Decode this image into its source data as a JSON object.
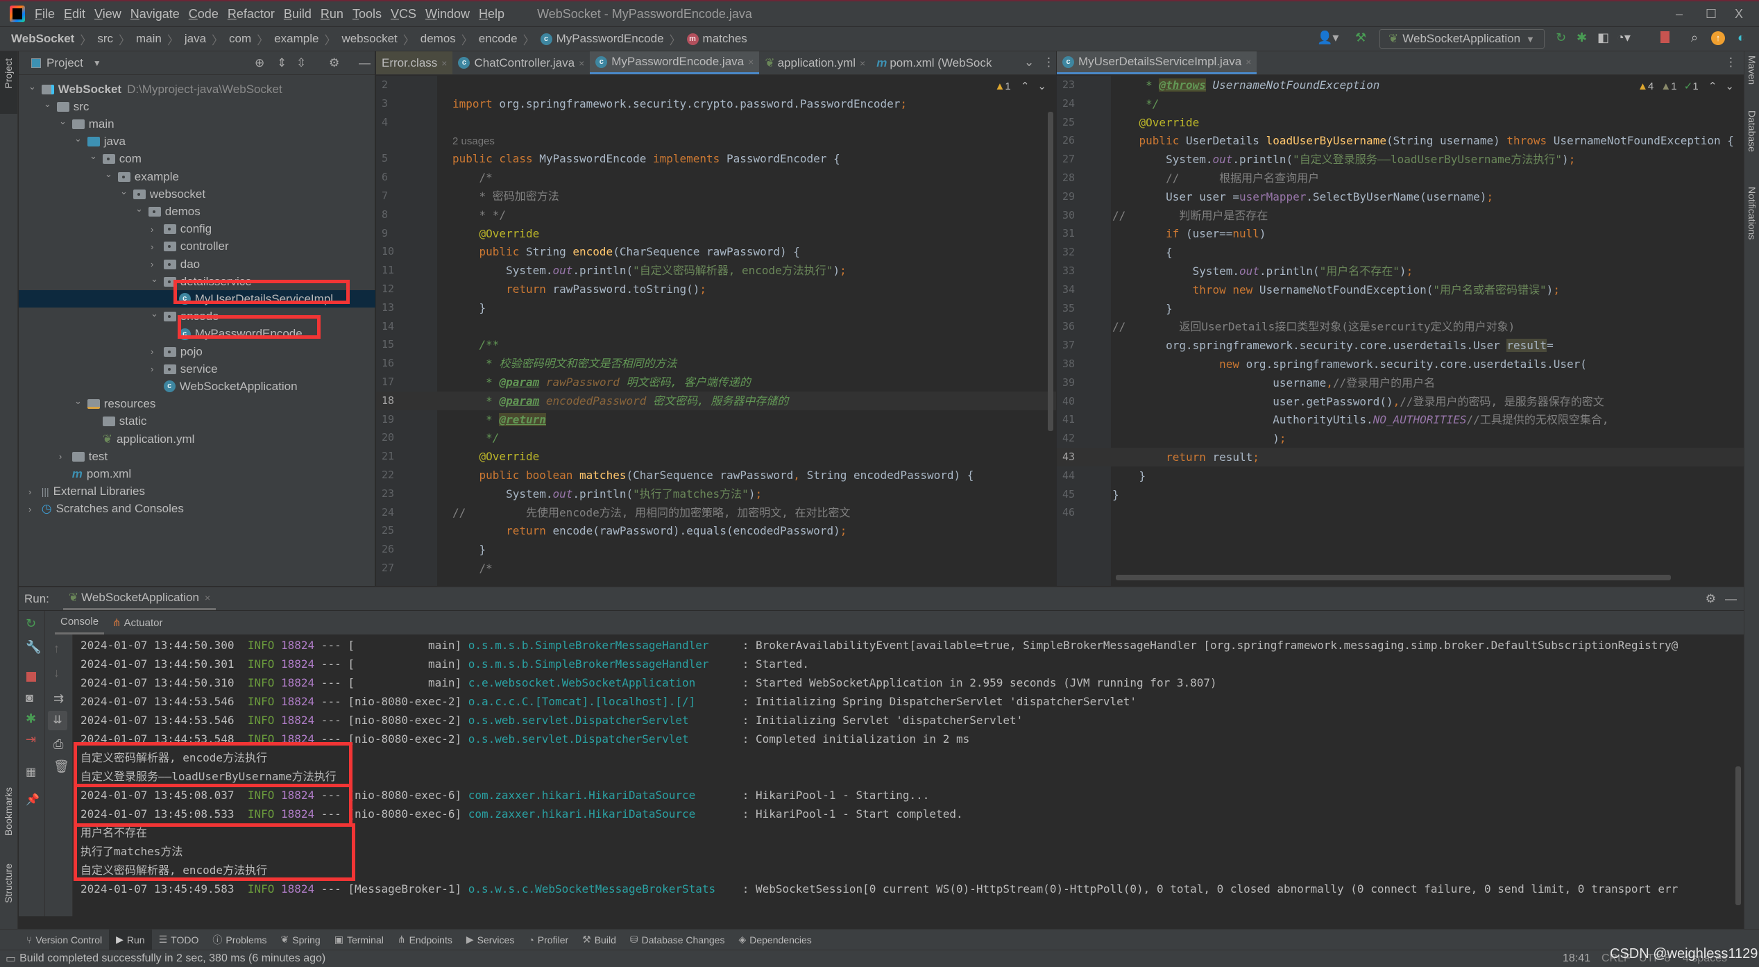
{
  "window": {
    "title": "WebSocket - MyPasswordEncode.java",
    "menu": [
      "File",
      "Edit",
      "View",
      "Navigate",
      "Code",
      "Refactor",
      "Build",
      "Run",
      "Tools",
      "VCS",
      "Window",
      "Help"
    ],
    "controls": {
      "minimize": "–",
      "maximize": "☐",
      "close": "X"
    }
  },
  "breadcrumb": {
    "items": [
      "WebSocket",
      "src",
      "main",
      "java",
      "com",
      "example",
      "websocket",
      "demos",
      "encode",
      "MyPasswordEncode",
      "matches"
    ]
  },
  "toolbar": {
    "run_config": "WebSocketApplication"
  },
  "side_strips": {
    "left_top": "Project",
    "left_bottom": [
      "Bookmarks",
      "Structure"
    ],
    "right": [
      "Maven",
      "Database",
      "Notifications"
    ]
  },
  "project": {
    "title": "Project",
    "tree": [
      {
        "label": "WebSocket",
        "extra": "D:\\Myproject-java\\WebSocket",
        "depth": 0,
        "type": "module",
        "expanded": true
      },
      {
        "label": "src",
        "depth": 1,
        "type": "folder",
        "expanded": true
      },
      {
        "label": "main",
        "depth": 2,
        "type": "folder",
        "expanded": true
      },
      {
        "label": "java",
        "depth": 3,
        "type": "src",
        "expanded": true
      },
      {
        "label": "com",
        "depth": 4,
        "type": "pkg",
        "expanded": true
      },
      {
        "label": "example",
        "depth": 5,
        "type": "pkg",
        "expanded": true
      },
      {
        "label": "websocket",
        "depth": 6,
        "type": "pkg",
        "expanded": true
      },
      {
        "label": "demos",
        "depth": 7,
        "type": "pkg",
        "expanded": true
      },
      {
        "label": "config",
        "depth": 8,
        "type": "pkg",
        "expanded": false
      },
      {
        "label": "controller",
        "depth": 8,
        "type": "pkg",
        "expanded": false
      },
      {
        "label": "dao",
        "depth": 8,
        "type": "pkg",
        "expanded": false
      },
      {
        "label": "detailsservice",
        "depth": 8,
        "type": "pkg",
        "expanded": true
      },
      {
        "label": "MyUserDetailsServiceImpl",
        "depth": 9,
        "type": "class",
        "selected": true
      },
      {
        "label": "encode",
        "depth": 8,
        "type": "pkg",
        "expanded": true
      },
      {
        "label": "MyPasswordEncode",
        "depth": 9,
        "type": "class"
      },
      {
        "label": "pojo",
        "depth": 8,
        "type": "pkg",
        "expanded": false
      },
      {
        "label": "service",
        "depth": 8,
        "type": "pkg",
        "expanded": false
      },
      {
        "label": "WebSocketApplication",
        "depth": 8,
        "type": "springapp"
      },
      {
        "label": "resources",
        "depth": 3,
        "type": "res",
        "expanded": true
      },
      {
        "label": "static",
        "depth": 4,
        "type": "folder"
      },
      {
        "label": "application.yml",
        "depth": 4,
        "type": "yml"
      },
      {
        "label": "test",
        "depth": 2,
        "type": "folder",
        "expanded": false
      },
      {
        "label": "pom.xml",
        "depth": 2,
        "type": "maven"
      },
      {
        "label": "External Libraries",
        "depth": 0,
        "type": "libs",
        "expanded": false
      },
      {
        "label": "Scratches and Consoles",
        "depth": 0,
        "type": "scratch",
        "expanded": false
      }
    ]
  },
  "editor_left": {
    "tabs": [
      {
        "label": "Error.class",
        "active": false
      },
      {
        "label": "ChatController.java",
        "active": false
      },
      {
        "label": "MyPasswordEncode.java",
        "active": true
      },
      {
        "label": "application.yml",
        "active": false
      },
      {
        "label": "pom.xml (WebSock",
        "active": false
      }
    ],
    "inspection": "1",
    "usages": "2 usages",
    "lines": [
      {
        "n": "2",
        "html": ""
      },
      {
        "n": "3",
        "html": "<span class='kw'>import</span> org.springframework.security.crypto.password.PasswordEncoder<span class='kw'>;</span>"
      },
      {
        "n": "4",
        "html": ""
      },
      {
        "n": "",
        "html": "<span style='color:#787878;font-family:Liberation Sans,sans-serif;font-size:15px'>2 usages</span>"
      },
      {
        "n": "5",
        "html": "<span class='kw'>public class</span> MyPasswordEncode <span class='kw'>implements</span> PasswordEncoder {"
      },
      {
        "n": "6",
        "html": "    <span class='cmt'>/*</span>"
      },
      {
        "n": "7",
        "html": "    <span class='cmt'>* 密码加密方法</span>"
      },
      {
        "n": "8",
        "html": "    <span class='cmt'>* */</span>"
      },
      {
        "n": "9",
        "html": "    <span class='ann'>@Override</span>"
      },
      {
        "n": "10",
        "html": "    <span class='kw'>public</span> String <span class='fn'>encode</span>(CharSequence rawPassword) {"
      },
      {
        "n": "11",
        "html": "        System.<span class='fld'>out</span>.println(<span class='str'>\"自定义密码解析器, encode方法执行\"</span>)<span class='kw'>;</span>"
      },
      {
        "n": "12",
        "html": "        <span class='kw'>return</span> rawPassword.toString()<span class='kw'>;</span>"
      },
      {
        "n": "13",
        "html": "    }"
      },
      {
        "n": "14",
        "html": ""
      },
      {
        "n": "15",
        "html": "    <span class='doc'>/**</span>"
      },
      {
        "n": "16",
        "html": "     <span class='doc'>* 校验密码明文和密文是否相同的方法</span>"
      },
      {
        "n": "17",
        "html": "     <span class='doc'>* </span><span class='doctag'>@param</span> <span class='dparam'>rawPassword</span> <span class='doc'>明文密码, 客户端传递的</span>"
      },
      {
        "n": "18",
        "html": "     <span class='doc'>* </span><span class='doctag'>@param</span> <span class='dparam'>encodedPassword</span> <span class='doc'>密文密码, 服务器中存储的</span>",
        "cur": true
      },
      {
        "n": "19",
        "html": "     <span class='doc'>* </span><span class='doctag' style='background:#4a4a2e'>@return</span>"
      },
      {
        "n": "20",
        "html": "     <span class='doc'>*/</span>"
      },
      {
        "n": "21",
        "html": "    <span class='ann'>@Override</span>"
      },
      {
        "n": "22",
        "html": "    <span class='kw'>public boolean</span> <span class='fn'>matches</span>(CharSequence rawPassword<span class='kw'>,</span> String encodedPassword) {"
      },
      {
        "n": "23",
        "html": "        System.<span class='fld'>out</span>.println(<span class='str'>\"执行了matches方法\"</span>)<span class='kw'>;</span>"
      },
      {
        "n": "24",
        "html": "<span class='cmt'>//         先使用encode方法, 用相同的加密策略, 加密明文, 在对比密文</span>"
      },
      {
        "n": "25",
        "html": "        <span class='kw'>return</span> encode(rawPassword).equals(encodedPassword)<span class='kw'>;</span>"
      },
      {
        "n": "26",
        "html": "    }"
      },
      {
        "n": "27",
        "html": "    <span class='cmt'>/*</span>"
      }
    ]
  },
  "editor_right": {
    "tabs": [
      {
        "label": "MyUserDetailsServiceImpl.java",
        "active": true
      }
    ],
    "inspection": {
      "warnings": "4",
      "weak_warnings": "1",
      "typos": "1"
    },
    "lines": [
      {
        "n": "23",
        "html": "     <span class='doc'>* </span><span class='doctag' style='background:#4a4a2e'>@throws</span> <span class='doc' style='color:#a9b7c6'>UsernameNotFoundException</span>"
      },
      {
        "n": "24",
        "html": "     <span class='doc'>*/</span>"
      },
      {
        "n": "25",
        "html": "    <span class='ann'>@Override</span>"
      },
      {
        "n": "26",
        "html": "    <span class='kw'>public</span> UserDetails <span class='fn'>loadUserByUsername</span>(String username) <span class='kw'>throws</span> UsernameNotFoundException {"
      },
      {
        "n": "27",
        "html": "        System.<span class='fld'>out</span>.println(<span class='str'>\"自定义登录服务——loadUserByUsername方法执行\"</span>)<span class='kw'>;</span>"
      },
      {
        "n": "28",
        "html": "        <span class='cmt'>//      根据用户名查询用户</span>"
      },
      {
        "n": "29",
        "html": "        User user =<span class='fld' style='font-style:normal'>userMapper</span>.SelectByUserName(username)<span class='kw'>;</span>"
      },
      {
        "n": "30",
        "html": "<span class='cmt'>//        判断用户是否存在</span>"
      },
      {
        "n": "31",
        "html": "        <span class='kw'>if</span> (user==<span class='kw'>null</span>)"
      },
      {
        "n": "32",
        "html": "        {"
      },
      {
        "n": "33",
        "html": "            System.<span class='fld'>out</span>.println(<span class='str'>\"用户名不存在\"</span>)<span class='kw'>;</span>"
      },
      {
        "n": "34",
        "html": "            <span class='kw'>throw new</span> UsernameNotFoundException(<span class='str'>\"用户名或者密码错误\"</span>)<span class='kw'>;</span>"
      },
      {
        "n": "35",
        "html": "        }"
      },
      {
        "n": "36",
        "html": "<span class='cmt'>//        返回UserDetails接口类型对象(这是sercurity定义的用户对象)</span>"
      },
      {
        "n": "37",
        "html": "        org.springframework.security.core.userdetails.User <span style='background:#4a4a3a'>result</span>="
      },
      {
        "n": "38",
        "html": "                <span class='kw'>new</span> org.springframework.security.core.userdetails.User("
      },
      {
        "n": "39",
        "html": "                        username<span class='kw'>,</span><span class='cmt'>//登录用户的用户名</span>"
      },
      {
        "n": "40",
        "html": "                        user.getPassword()<span class='kw'>,</span><span class='cmt'>//登录用户的密码, 是服务器保存的密文</span>"
      },
      {
        "n": "41",
        "html": "                        AuthorityUtils.<span class='fld'>NO_AUTHORITIES</span><span class='cmt'>//工具提供的无权限空集合,</span>"
      },
      {
        "n": "42",
        "html": "                        )<span class='kw'>;</span>"
      },
      {
        "n": "43",
        "html": "        <span class='kw'>return</span> result<span class='kw'>;</span>",
        "cur": true
      },
      {
        "n": "44",
        "html": "    }"
      },
      {
        "n": "45",
        "html": "}"
      },
      {
        "n": "46",
        "html": ""
      }
    ]
  },
  "run": {
    "label": "Run:",
    "config": "WebSocketApplication",
    "tabs": [
      "Console",
      "Actuator"
    ],
    "console": [
      {
        "ts": "2024-01-07 13:44:50.300",
        "lvl": "INFO",
        "pid": "18824",
        "thread": "[           main]",
        "cls": "o.s.m.s.b.SimpleBrokerMessageHandler    ",
        "msg": ": BrokerAvailabilityEvent[available=true, SimpleBrokerMessageHandler [org.springframework.messaging.simp.broker.DefaultSubscriptionRegistry@"
      },
      {
        "ts": "2024-01-07 13:44:50.301",
        "lvl": "INFO",
        "pid": "18824",
        "thread": "[           main]",
        "cls": "o.s.m.s.b.SimpleBrokerMessageHandler    ",
        "msg": ": Started."
      },
      {
        "ts": "2024-01-07 13:44:50.310",
        "lvl": "INFO",
        "pid": "18824",
        "thread": "[           main]",
        "cls": "c.e.websocket.WebSocketApplication      ",
        "msg": ": Started WebSocketApplication in 2.959 seconds (JVM running for 3.807)"
      },
      {
        "ts": "2024-01-07 13:44:53.546",
        "lvl": "INFO",
        "pid": "18824",
        "thread": "[nio-8080-exec-2]",
        "cls": "o.a.c.c.C.[Tomcat].[localhost].[/]      ",
        "msg": ": Initializing Spring DispatcherServlet 'dispatcherServlet'"
      },
      {
        "ts": "2024-01-07 13:44:53.546",
        "lvl": "INFO",
        "pid": "18824",
        "thread": "[nio-8080-exec-2]",
        "cls": "o.s.web.servlet.DispatcherServlet       ",
        "msg": ": Initializing Servlet 'dispatcherServlet'"
      },
      {
        "ts": "2024-01-07 13:44:53.548",
        "lvl": "INFO",
        "pid": "18824",
        "thread": "[nio-8080-exec-2]",
        "cls": "o.s.web.servlet.DispatcherServlet       ",
        "msg": ": Completed initialization in 2 ms"
      },
      {
        "plain": "自定义密码解析器, encode方法执行"
      },
      {
        "plain": "自定义登录服务——loadUserByUsername方法执行"
      },
      {
        "ts": "2024-01-07 13:45:08.037",
        "lvl": "INFO",
        "pid": "18824",
        "thread": "[nio-8080-exec-6]",
        "cls": "com.zaxxer.hikari.HikariDataSource      ",
        "msg": ": HikariPool-1 - Starting..."
      },
      {
        "ts": "2024-01-07 13:45:08.533",
        "lvl": "INFO",
        "pid": "18824",
        "thread": "[nio-8080-exec-6]",
        "cls": "com.zaxxer.hikari.HikariDataSource      ",
        "msg": ": HikariPool-1 - Start completed."
      },
      {
        "plain": "用户名不存在"
      },
      {
        "plain": "执行了matches方法"
      },
      {
        "plain": "自定义密码解析器, encode方法执行"
      },
      {
        "ts": "2024-01-07 13:45:49.583",
        "lvl": "INFO",
        "pid": "18824",
        "thread": "[MessageBroker-1]",
        "cls": "o.s.w.s.c.WebSocketMessageBrokerStats   ",
        "msg": ": WebSocketSession[0 current WS(0)-HttpStream(0)-HttpPoll(0), 0 total, 0 closed abnormally (0 connect failure, 0 send limit, 0 transport err"
      }
    ]
  },
  "bottom_tools": [
    "Version Control",
    "Run",
    "TODO",
    "Problems",
    "Spring",
    "Terminal",
    "Endpoints",
    "Services",
    "Profiler",
    "Build",
    "Database Changes",
    "Dependencies"
  ],
  "status": {
    "message": "Build completed successfully in 2 sec, 380 ms (6 minutes ago)",
    "position": "18:41",
    "line_sep": "CRLF",
    "encoding": "UTF-8",
    "indent": "4 spaces",
    "watermark": "CSDN @weighless1129"
  },
  "colors": {
    "highlight_box": "#f23535",
    "accent_tab": "#4a88c7"
  }
}
